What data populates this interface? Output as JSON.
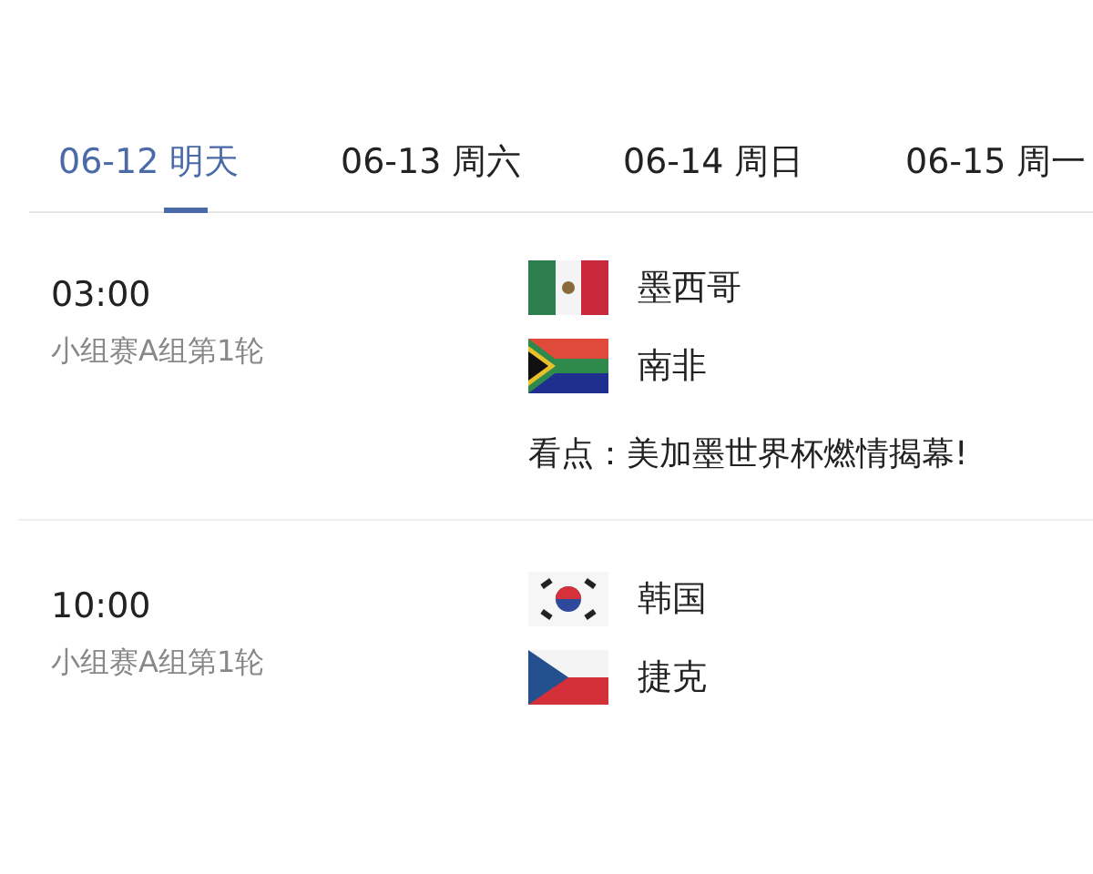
{
  "tabs": [
    {
      "label": "06-12 明天",
      "selected": true
    },
    {
      "label": "06-13 周六",
      "selected": false
    },
    {
      "label": "06-14 周日",
      "selected": false
    },
    {
      "label": "06-15 周一",
      "selected": false
    }
  ],
  "matches": [
    {
      "time": "03:00",
      "stage": "小组赛A组第1轮",
      "teams": [
        {
          "name": "墨西哥",
          "kind": "mexico"
        },
        {
          "name": "南非",
          "kind": "south-africa"
        }
      ],
      "highlight": "看点：美加墨世界杯燃情揭幕!"
    },
    {
      "time": "10:00",
      "stage": "小组赛A组第1轮",
      "teams": [
        {
          "name": "韩国",
          "kind": "korea"
        },
        {
          "name": "捷克",
          "kind": "czech"
        }
      ]
    }
  ]
}
